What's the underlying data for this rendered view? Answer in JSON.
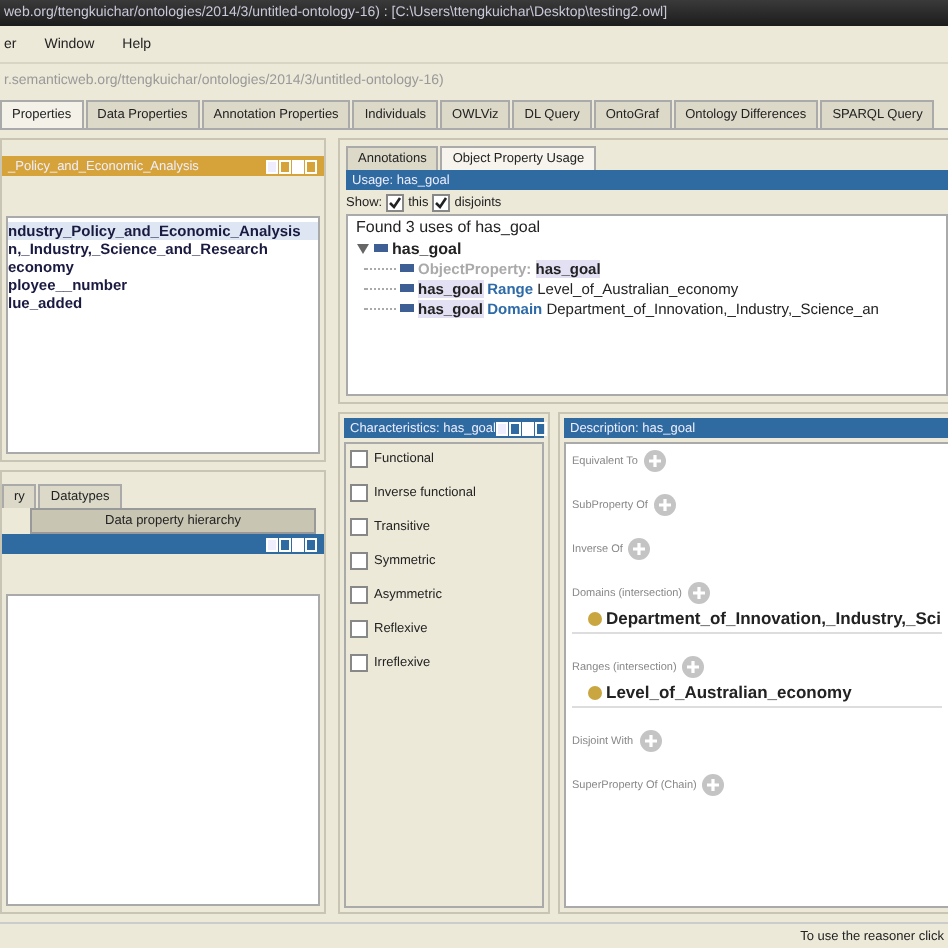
{
  "window": {
    "title": "web.org/ttengkuichar/ontologies/2014/3/untitled-ontology-16)  :  [C:\\Users\\ttengkuichar\\Desktop\\testing2.owl]"
  },
  "menu": [
    "er",
    "Window",
    "Help"
  ],
  "address": "r.semanticweb.org/ttengkuichar/ontologies/2014/3/untitled-ontology-16)",
  "tabs": [
    {
      "label": "Properties",
      "selected": true
    },
    {
      "label": "Data Properties",
      "selected": false
    },
    {
      "label": "Annotation Properties",
      "selected": false
    },
    {
      "label": "Individuals",
      "selected": false
    },
    {
      "label": "OWLViz",
      "selected": false
    },
    {
      "label": "DL Query",
      "selected": false
    },
    {
      "label": "OntoGraf",
      "selected": false
    },
    {
      "label": "Ontology Differences",
      "selected": false
    },
    {
      "label": "SPARQL Query",
      "selected": false
    }
  ],
  "class_panel": {
    "header": "_Policy_and_Economic_Analysis",
    "items": [
      {
        "label": "ndustry_Policy_and_Economic_Analysis",
        "selected": true
      },
      {
        "label": "n,_Industry,_Science_and_Research",
        "selected": false
      },
      {
        "label": "economy",
        "selected": false
      },
      {
        "label": "ployee__number",
        "selected": false
      },
      {
        "label": "lue_added",
        "selected": false
      }
    ]
  },
  "hierarchy_panel": {
    "tabs": [
      {
        "label": "ry",
        "selected": false
      },
      {
        "label": "Datatypes",
        "selected": false
      }
    ],
    "lower_tab": {
      "label": "Data property hierarchy",
      "selected": true
    }
  },
  "usage_panel": {
    "tabs": [
      {
        "label": "Annotations",
        "selected": false
      },
      {
        "label": "Object Property Usage",
        "selected": true
      }
    ],
    "header": "Usage: has_goal",
    "show_label": "Show:",
    "options": [
      {
        "label": "this",
        "checked": true
      },
      {
        "label": "disjoints",
        "checked": true
      }
    ],
    "found": "Found 3 uses of has_goal",
    "tree": {
      "label": "has_goal",
      "expanded": true,
      "children": [
        {
          "parts": [
            {
              "kind": "label",
              "text": "ObjectProperty:"
            },
            {
              "kind": "entity",
              "text": "has_goal"
            }
          ]
        },
        {
          "parts": [
            {
              "kind": "entity",
              "text": "has_goal"
            },
            {
              "kind": "keyword",
              "text": "Range"
            },
            {
              "kind": "text",
              "text": "Level_of_Australian_economy"
            }
          ]
        },
        {
          "parts": [
            {
              "kind": "entity",
              "text": "has_goal"
            },
            {
              "kind": "keyword",
              "text": "Domain"
            },
            {
              "kind": "text",
              "text": "Department_of_Innovation,_Industry,_Science_an"
            }
          ]
        }
      ]
    }
  },
  "characteristics": {
    "header": "Characteristics: has_goal",
    "items": [
      {
        "label": "Functional",
        "checked": false
      },
      {
        "label": "Inverse functional",
        "checked": false
      },
      {
        "label": "Transitive",
        "checked": false
      },
      {
        "label": "Symmetric",
        "checked": false
      },
      {
        "label": "Asymmetric",
        "checked": false
      },
      {
        "label": "Reflexive",
        "checked": false
      },
      {
        "label": "Irreflexive",
        "checked": false
      }
    ]
  },
  "description": {
    "header": "Description: has_goal",
    "sections": [
      {
        "label": "Equivalent To"
      },
      {
        "label": "SubProperty Of"
      },
      {
        "label": "Inverse Of"
      },
      {
        "label": "Domains (intersection)",
        "values": [
          "Department_of_Innovation,_Industry,_Sci"
        ]
      },
      {
        "label": "Ranges (intersection)",
        "values": [
          "Level_of_Australian_economy"
        ]
      },
      {
        "label": "Disjoint With"
      },
      {
        "label": "SuperProperty Of (Chain)"
      }
    ]
  },
  "status": "To use the reasoner click"
}
